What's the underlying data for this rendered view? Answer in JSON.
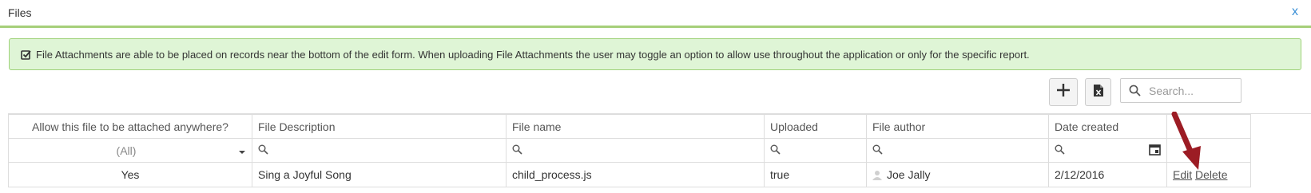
{
  "window": {
    "title": "Files",
    "close_label": "x"
  },
  "info": {
    "text": "File Attachments are able to be placed on records near the bottom of the edit form. When uploading File Attachments the user may toggle an option to allow use throughout the application or only for the specific report."
  },
  "toolbar": {
    "search_placeholder": "Search..."
  },
  "columns": [
    "Allow this file to be attached anywhere?",
    "File Description",
    "File name",
    "Uploaded",
    "File author",
    "Date created"
  ],
  "filter": {
    "allow_value": "(All)"
  },
  "rows": [
    {
      "allow": "Yes",
      "description": "Sing a Joyful Song",
      "filename": "child_process.js",
      "uploaded": "true",
      "author": "Joe Jally",
      "created": "2/12/2016",
      "edit_label": "Edit",
      "delete_label": "Delete"
    }
  ],
  "colors": {
    "accent": "#a6cf7a",
    "info_bg": "#dff5d6",
    "link": "#3a8fd6",
    "arrow": "#b0202a"
  }
}
